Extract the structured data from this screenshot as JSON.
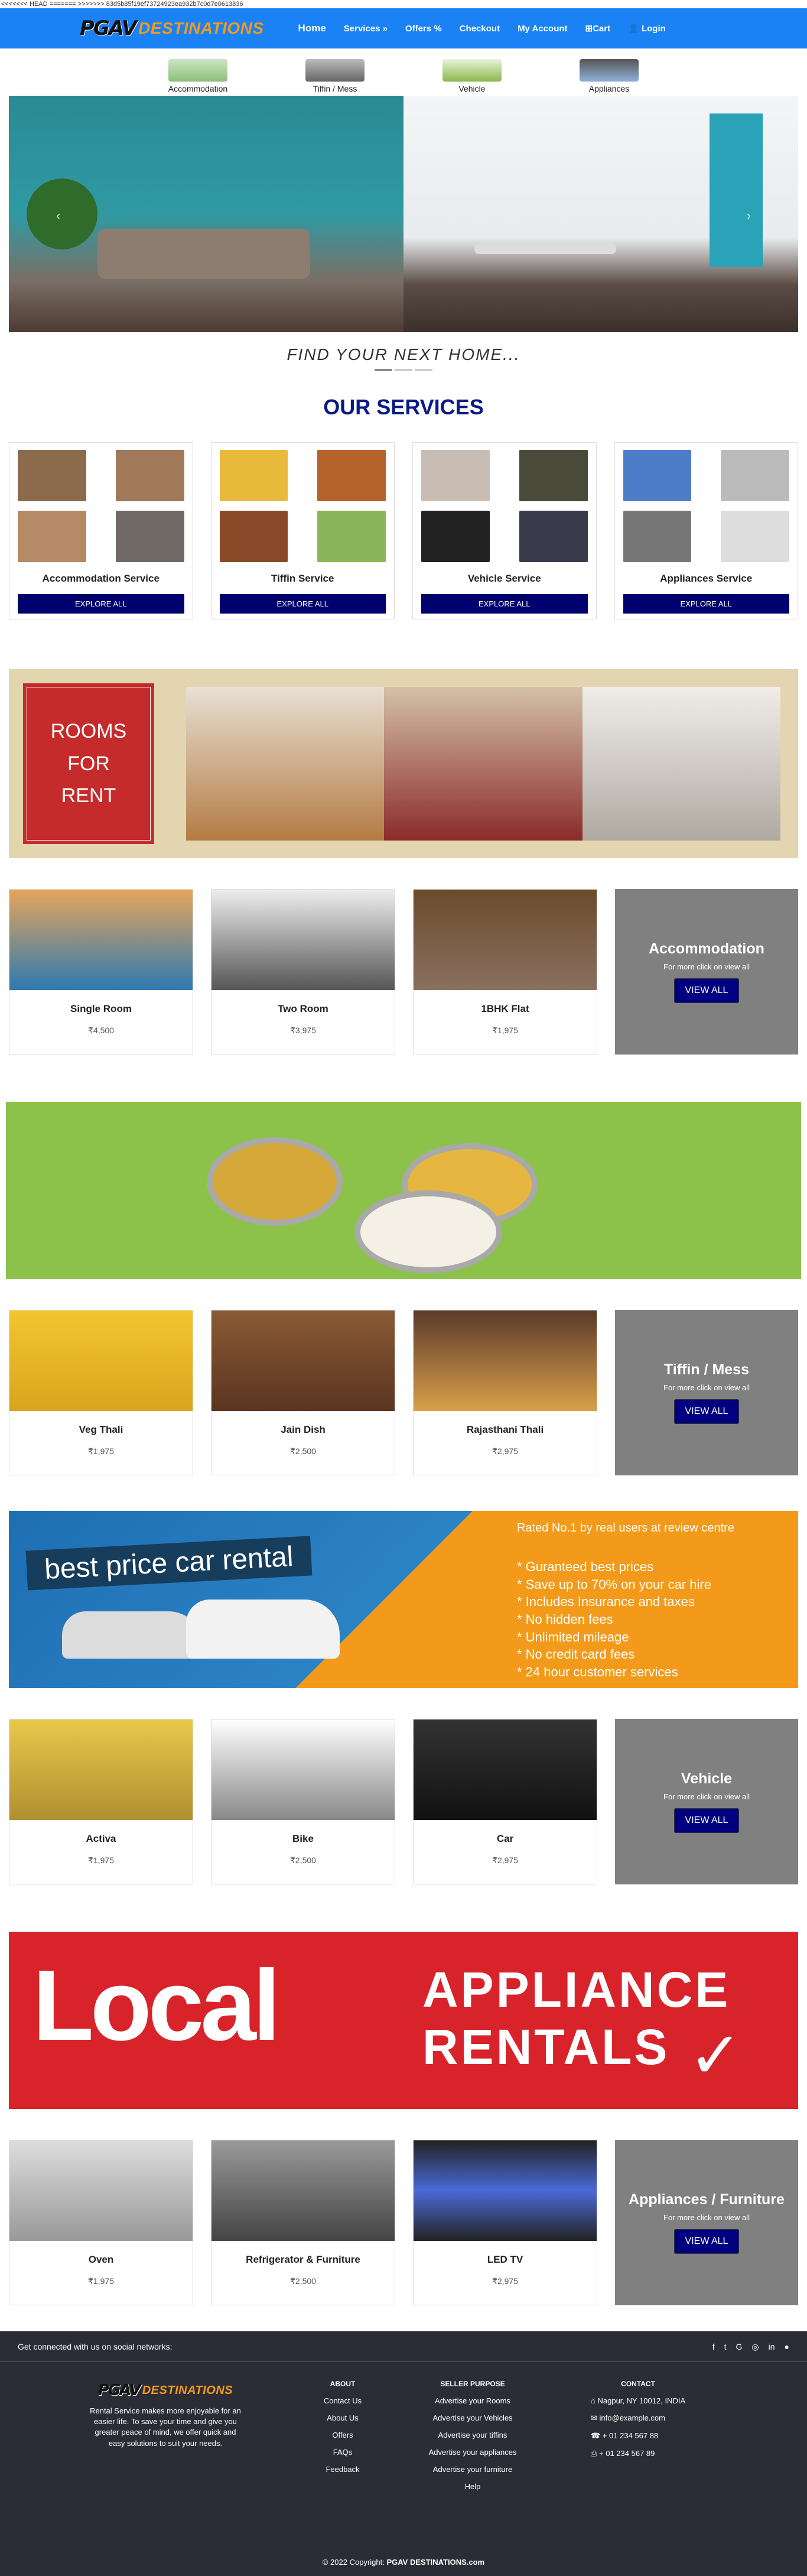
{
  "git_marker": "<<<<<<< HEAD ======= >>>>>>> 83d5b85f19ef73724923ea932b7c0d7e0613836",
  "brand": {
    "part1": "PGAV",
    "part2": "DESTINATIONS"
  },
  "nav": {
    "home": "Home",
    "services": "Services",
    "offers": "Offers %",
    "checkout": "Checkout",
    "account": "My Account",
    "cart": "Cart",
    "login": "Login"
  },
  "categories": [
    "Accommodation",
    "Tiffin / Mess",
    "Vehicle",
    "Appliances"
  ],
  "hero": {
    "caption": "FIND YOUR NEXT HOME..."
  },
  "services": {
    "heading": "OUR SERVICES",
    "cards": [
      {
        "title": "Accommodation Service",
        "button": "EXPLORE ALL"
      },
      {
        "title": "Tiffin Service",
        "button": "EXPLORE ALL"
      },
      {
        "title": "Vehicle Service",
        "button": "EXPLORE ALL"
      },
      {
        "title": "Appliances Service",
        "button": "EXPLORE ALL"
      }
    ]
  },
  "rooms_banner": {
    "line1": "ROOMS",
    "line2": "FOR",
    "line3": "RENT"
  },
  "accommodation": {
    "items": [
      {
        "name": "Single Room",
        "price": "₹4,500"
      },
      {
        "name": "Two Room",
        "price": "₹3,975"
      },
      {
        "name": "1BHK Flat",
        "price": "₹1,975"
      }
    ],
    "promo": {
      "title": "Accommodation",
      "sub": "For more click on view all",
      "button": "VIEW ALL"
    }
  },
  "tiffin": {
    "items": [
      {
        "name": "Veg Thali",
        "price": "₹1,975"
      },
      {
        "name": "Jain Dish",
        "price": "₹2,500"
      },
      {
        "name": "Rajasthani Thali",
        "price": "₹2,975"
      }
    ],
    "promo": {
      "title": "Tiffin / Mess",
      "sub": "For more click on view all",
      "button": "VIEW ALL"
    }
  },
  "car_banner": {
    "headline": "best price car rental",
    "rated": "Rated No.1 by real users at review centre",
    "bullets": [
      "* Guranteed best prices",
      "* Save up to 70% on your car hire",
      "* Includes Insurance and taxes",
      "* No hidden fees",
      "* Unlimited mileage",
      "* No credit card fees",
      "* 24 hour customer services"
    ]
  },
  "vehicle": {
    "items": [
      {
        "name": "Activa",
        "price": "₹1,975"
      },
      {
        "name": "Bike",
        "price": "₹2,500"
      },
      {
        "name": "Car",
        "price": "₹2,975"
      }
    ],
    "promo": {
      "title": "Vehicle",
      "sub": "For more click on view all",
      "button": "VIEW ALL"
    }
  },
  "appliance_banner": {
    "big": "Local",
    "line1": "APPLIANCE",
    "line2": "RENTALS",
    "tick": "✓"
  },
  "appliances": {
    "items": [
      {
        "name": "Oven",
        "price": "₹1,975"
      },
      {
        "name": "Refrigerator & Furniture",
        "price": "₹2,500"
      },
      {
        "name": "LED TV",
        "price": "₹2,975"
      }
    ],
    "promo": {
      "title": "Appliances / Furniture",
      "sub": "For more click on view all",
      "button": "VIEW ALL"
    }
  },
  "footer": {
    "social_text": "Get connected with us on social networks:",
    "social_icons": [
      "f",
      "t",
      "G",
      "◎",
      "in",
      "●"
    ],
    "about_text": "Rental Service makes more enjoyable for an easier life. To save your time and give you greater peace of mind, we offer quick and easy solutions to suit your needs.",
    "about": {
      "title": "ABOUT",
      "links": [
        "Contact Us",
        "About Us",
        "Offers",
        "FAQs",
        "Feedback"
      ]
    },
    "seller": {
      "title": "SELLER PURPOSE",
      "links": [
        "Advertise your Rooms",
        "Advertise your Vehicles",
        "Advertise your tiffins",
        "Advertise your appliances",
        "Advertise your furniture",
        "Help"
      ]
    },
    "contact": {
      "title": "CONTACT",
      "address": "Nagpur, NY 10012, INDIA",
      "email": "info@example.com",
      "phone": "+ 01 234 567 88",
      "fax": "+ 01 234 567 89"
    },
    "copyright_prefix": "© 2022 Copyright: ",
    "copyright_site": "PGAV DESTINATIONS.com"
  },
  "colors": {
    "nav": "#1a82f5",
    "accent": "#f39a1a",
    "button": "#00006e",
    "footer": "#2b2d36"
  }
}
